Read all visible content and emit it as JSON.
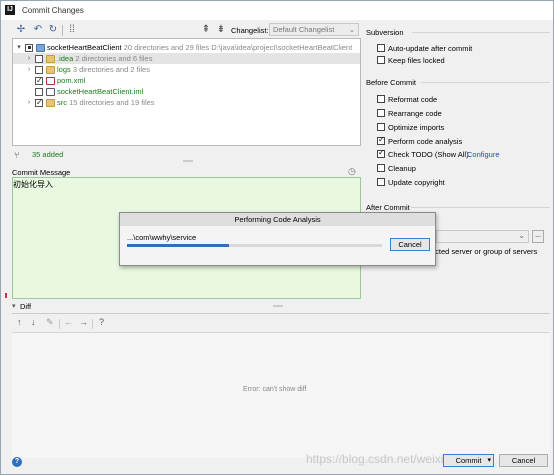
{
  "window": {
    "title": "Commit Changes",
    "app_icon_letter": "IJ"
  },
  "toolbar": {
    "changelist_label": "Changelist:",
    "changelist_value": "Default Changelist"
  },
  "tree": {
    "root": {
      "name": "socketHeartBeatClient",
      "info": "20 directories and 29 files",
      "path": "D:\\java\\idea\\project\\socketHeartBeatClient"
    },
    "items": [
      {
        "name": ".idea",
        "info": "2 directories and 6 files"
      },
      {
        "name": "logs",
        "info": "3 directories and 2 files"
      },
      {
        "name": "pom.xml",
        "info": ""
      },
      {
        "name": "socketHeartBeatClient.iml",
        "info": ""
      },
      {
        "name": "src",
        "info": "15 directories and 19 files"
      }
    ],
    "summary": "35 added"
  },
  "commit_message": {
    "label": "Commit Message",
    "text": "初始化导入"
  },
  "right_panel": {
    "subversion_header": "Subversion",
    "subversion_options": [
      {
        "label": "Auto-update after commit",
        "checked": false
      },
      {
        "label": "Keep files locked",
        "checked": false
      }
    ],
    "before_commit_header": "Before Commit",
    "before_commit_options": [
      {
        "label": "Reformat code",
        "checked": false
      },
      {
        "label": "Rearrange code",
        "checked": false
      },
      {
        "label": "Optimize imports",
        "checked": false
      },
      {
        "label": "Perform code analysis",
        "checked": true
      },
      {
        "label": "Check TODO (Show All)",
        "checked": true,
        "link": "Configure"
      },
      {
        "label": "Cleanup",
        "checked": false
      },
      {
        "label": "Update copyright",
        "checked": false
      }
    ],
    "after_commit_header": "After Commit",
    "after_commit_text": "ected server or group of servers"
  },
  "progress_dialog": {
    "title": "Performing Code Analysis",
    "path": "...\\com\\wwhy\\service",
    "cancel_label": "Cancel",
    "progress": 0.4
  },
  "diff": {
    "label": "Diff",
    "empty_text": "Error: can't show diff"
  },
  "footer": {
    "help_icon": "?",
    "commit_label": "Commit",
    "cancel_label": "Cancel",
    "watermark": "https://blog.csdn.net/weixin_"
  }
}
